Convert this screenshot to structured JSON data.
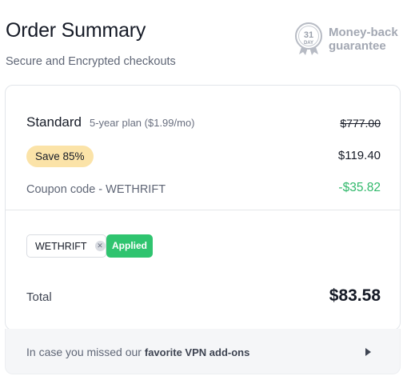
{
  "header": {
    "title": "Order Summary",
    "subtitle": "Secure and Encrypted checkouts"
  },
  "guarantee": {
    "days": "31",
    "day_label": "DAY",
    "label_line1": "Money-back",
    "label_line2": "guarantee",
    "icon": "medal-icon"
  },
  "plan": {
    "name": "Standard",
    "description": "5-year plan ($1.99/mo)",
    "original_price": "$777.00",
    "save_label": "Save 85%",
    "price": "$119.40"
  },
  "coupon": {
    "label": "Coupon code - WETHRIFT",
    "discount": "-$35.82",
    "code": "WETHRIFT",
    "status": "Applied"
  },
  "total": {
    "label": "Total",
    "amount": "$83.58"
  },
  "addons": {
    "text_prefix": "In case you missed our ",
    "text_bold": "favorite VPN add-ons"
  },
  "colors": {
    "accent_green": "#2fc46f",
    "discount_green": "#2fb86a",
    "save_badge_bg": "#fbe3a8"
  }
}
